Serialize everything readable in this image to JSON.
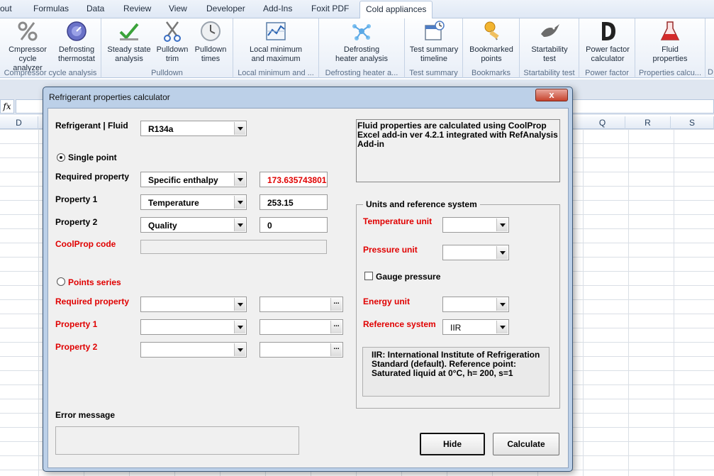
{
  "ribbon": {
    "tabs": [
      "out",
      "Formulas",
      "Data",
      "Review",
      "View",
      "Developer",
      "Add-Ins",
      "Foxit PDF",
      "Cold appliances"
    ],
    "active_tab": "Cold appliances",
    "groups": [
      {
        "name": "Compressor cycle analysis",
        "buttons": [
          {
            "l1": "Cmpressor",
            "l2": "cycle analyzer",
            "icon": "percent-icon"
          },
          {
            "l1": "Defrosting",
            "l2": "thermostat",
            "icon": "thermostat-icon"
          }
        ]
      },
      {
        "name": "Pulldown",
        "buttons": [
          {
            "l1": "Steady state",
            "l2": "analysis",
            "icon": "checkmark-icon"
          },
          {
            "l1": "Pulldown",
            "l2": "trim",
            "icon": "scissors-icon"
          },
          {
            "l1": "Pulldown",
            "l2": "times",
            "icon": "clock-icon"
          }
        ]
      },
      {
        "name": "Local minimum and ...",
        "buttons": [
          {
            "l1": "Local minimum",
            "l2": "and maximum",
            "icon": "chart-icon"
          }
        ]
      },
      {
        "name": "Defrosting heater a...",
        "buttons": [
          {
            "l1": "Defrosting",
            "l2": "heater analysis",
            "icon": "molecule-icon"
          }
        ]
      },
      {
        "name": "Test summary",
        "buttons": [
          {
            "l1": "Test summary",
            "l2": "timeline",
            "icon": "calendar-icon"
          }
        ]
      },
      {
        "name": "Bookmarks",
        "buttons": [
          {
            "l1": "Bookmarked",
            "l2": "points",
            "icon": "pushpin-icon"
          }
        ]
      },
      {
        "name": "Startability test",
        "buttons": [
          {
            "l1": "Startability",
            "l2": "test",
            "icon": "bird-icon"
          }
        ]
      },
      {
        "name": "Power factor",
        "buttons": [
          {
            "l1": "Power factor",
            "l2": "calculator",
            "icon": "letter-d-icon"
          }
        ]
      },
      {
        "name": "Properties calcu...",
        "buttons": [
          {
            "l1": "Fluid",
            "l2": "properties",
            "icon": "flask-icon"
          }
        ]
      }
    ],
    "trailing_group_letter": "D"
  },
  "sheet": {
    "fx": "fx",
    "columns": [
      "D",
      "Q",
      "R",
      "S"
    ]
  },
  "dialog": {
    "title": "Refrigerant properties calculator",
    "close": "x",
    "refrigerant_label": "Refrigerant | Fluid",
    "refrigerant_value": "R134a",
    "single_point_label": "Single point",
    "required_property_label": "Required property",
    "required_property_value": "Specific enthalpy",
    "required_property_result": "173.635743801",
    "property1_label": "Property 1",
    "property1_value": "Temperature",
    "property1_input": "253.15",
    "property2_label": "Property 2",
    "property2_value": "Quality",
    "property2_input": "0",
    "coolprop_code_label": "CoolProp code",
    "coolprop_code_value": "",
    "points_series_label": "Points series",
    "series_required_property_label": "Required property",
    "series_property1_label": "Property 1",
    "series_property2_label": "Property 2",
    "error_message_label": "Error message",
    "error_message_value": "",
    "info_text": "Fluid properties are calculated using CoolProp Excel add-in ver 4.2.1  integrated with RefAnalysis Add-in",
    "units_frame_title": "Units and reference system",
    "temperature_unit_label": "Temperature unit",
    "pressure_unit_label": "Pressure unit",
    "gauge_pressure_label": "Gauge pressure",
    "energy_unit_label": "Energy unit",
    "reference_system_label": "Reference system",
    "reference_system_value": "IIR",
    "reference_info": "IIR: International Institute of Refrigeration Standard (default). Reference point: Saturated liquid at 0°C, h= 200, s=1",
    "hide_button": "Hide",
    "calculate_button": "Calculate",
    "dots": "...",
    "required_result_color": "#e00000"
  }
}
